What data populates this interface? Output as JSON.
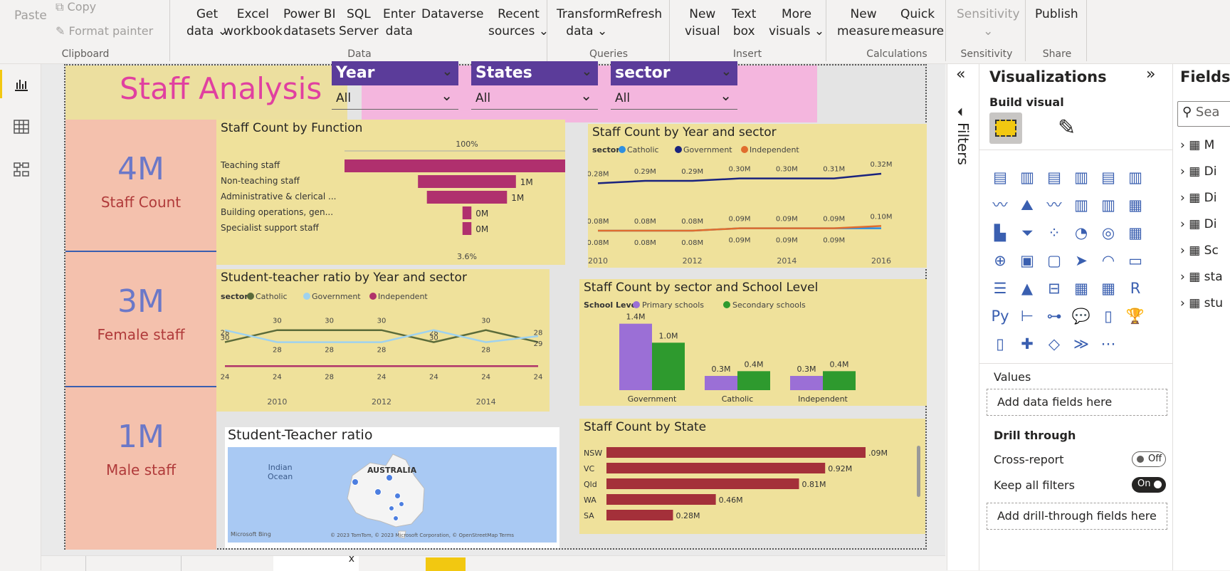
{
  "ribbon": {
    "clipboard": {
      "paste": "Paste",
      "copy": "Copy",
      "format_painter": "Format painter",
      "group": "Clipboard"
    },
    "data": {
      "get_data": "Get",
      "get_data2": "data",
      "excel": "Excel",
      "excel2": "workbook",
      "pbi": "Power BI",
      "pbi2": "datasets",
      "sql": "SQL",
      "sql2": "Server",
      "enter": "Enter",
      "enter2": "data",
      "dataverse": "Dataverse",
      "recent": "Recent",
      "recent2": "sources",
      "group": "Data"
    },
    "queries": {
      "transform": "Transform",
      "transform2": "data",
      "refresh": "Refresh",
      "group": "Queries"
    },
    "insert": {
      "new_visual": "New",
      "new_visual2": "visual",
      "text_box": "Text",
      "text_box2": "box",
      "more": "More",
      "more2": "visuals",
      "group": "Insert"
    },
    "calculations": {
      "new_measure": "New",
      "new_measure2": "measure",
      "quick": "Quick",
      "quick2": "measure",
      "group": "Calculations"
    },
    "sensitivity": {
      "label": "Sensitivity",
      "group": "Sensitivity"
    },
    "share": {
      "publish": "Publish",
      "group": "Share"
    }
  },
  "report": {
    "title": "Staff Analysis",
    "slicers": [
      {
        "label": "Year",
        "value": "All"
      },
      {
        "label": "States",
        "value": "All"
      },
      {
        "label": "sector",
        "value": "All"
      }
    ],
    "kpis": [
      {
        "value": "4M",
        "label": "Staff Count"
      },
      {
        "value": "3M",
        "label": "Female staff"
      },
      {
        "value": "1M",
        "label": "Male staff"
      }
    ],
    "funnel": {
      "title": "Staff Count by Function",
      "top_label": "100%",
      "bottom_label": "3.6%"
    },
    "line1": {
      "title": "Staff Count by Year and sector",
      "legend_title": "sector"
    },
    "line2": {
      "title": "Student-teacher ratio by Year and sector",
      "legend_title": "sector"
    },
    "bar1": {
      "title": "Staff Count by sector and School Level",
      "legend_title": "School Level"
    },
    "bar2": {
      "title": "Staff Count by State"
    },
    "map": {
      "title": "Student-Teacher ratio",
      "ocean": "Indian",
      "ocean2": "Ocean",
      "country": "AUSTRALIA",
      "bing": "Microsoft Bing",
      "copyright": "© 2023 TomTom, © 2023 Microsoft Corporation, © OpenStreetMap  Terms"
    }
  },
  "panes": {
    "filters": "Filters",
    "viz_title": "Visualizations",
    "build_visual": "Build visual",
    "values": "Values",
    "add_data": "Add data fields here",
    "drill_through": "Drill through",
    "cross_report": "Cross-report",
    "cross_report_state": "Off",
    "keep_filters": "Keep all filters",
    "keep_filters_state": "On",
    "add_drill": "Add drill-through fields here",
    "fields_title": "Fields",
    "search_placeholder": "Sea",
    "field_items": [
      "M",
      "Di",
      "Di",
      "Di",
      "Sc",
      "sta",
      "stu"
    ]
  },
  "colors": {
    "catholic_line2": "#5b6b3a",
    "government_line2": "#9fd2ef",
    "independent_line2": "#b0336a",
    "catholic_line1": "#2e8fe0",
    "government_line1": "#1a237e",
    "independent_line1": "#e06d2e",
    "primary": "#9b6fd6",
    "secondary": "#2e9a2e",
    "state_bar": "#a4303a",
    "funnel": "#b0306e",
    "kpi_value": "#6b78c8",
    "kpi_label": "#b03a3a",
    "title_pink": "#e040a0",
    "slicer_header": "#5b3c9a",
    "slicer_bg": "#f4b6de"
  },
  "chart_data": [
    {
      "type": "bar",
      "title": "Staff Count by Function",
      "categories": [
        "Teaching staff",
        "Non-teaching staff",
        "Administrative & clerical ...",
        "Building operations, gen...",
        "Specialist support staff"
      ],
      "values": [
        2.75,
        1.1,
        0.9,
        0.1,
        0.1
      ],
      "data_labels": [
        "",
        "1M",
        "1M",
        "0M",
        "0M"
      ]
    },
    {
      "type": "line",
      "title": "Staff Count by Year and sector",
      "x": [
        2010,
        2011,
        2012,
        2013,
        2014,
        2015,
        2016
      ],
      "x_ticks": [
        "2010",
        "2012",
        "2014",
        "2016"
      ],
      "series": [
        {
          "name": "Catholic",
          "values": [
            0.08,
            0.08,
            0.08,
            0.09,
            0.09,
            0.09,
            0.09
          ],
          "labels": [
            "0.08M",
            "0.08M",
            "0.08M",
            "0.09M",
            "0.09M",
            "0.09M",
            ""
          ]
        },
        {
          "name": "Government",
          "values": [
            0.28,
            0.29,
            0.29,
            0.3,
            0.3,
            0.3,
            0.32
          ],
          "labels": [
            "0.28M",
            "0.29M",
            "0.29M",
            "0.30M",
            "0.30M",
            "0.31M",
            "0.32M"
          ]
        },
        {
          "name": "Independent",
          "values": [
            0.08,
            0.08,
            0.08,
            0.09,
            0.09,
            0.09,
            0.1
          ],
          "labels": [
            "0.08M",
            "0.08M",
            "0.08M",
            "0.09M",
            "0.09M",
            "0.09M",
            "0.10M"
          ]
        }
      ]
    },
    {
      "type": "line",
      "title": "Student-teacher ratio by Year and sector",
      "x": [
        2009,
        2010,
        2011,
        2012,
        2013,
        2014,
        2015
      ],
      "x_ticks": [
        "2010",
        "2012",
        "2014"
      ],
      "series": [
        {
          "name": "Catholic",
          "values": [
            28,
            30,
            30,
            30,
            28,
            30,
            28
          ],
          "labels": [
            "28",
            "30",
            "30",
            "30",
            "28",
            "30",
            "28"
          ]
        },
        {
          "name": "Government",
          "values": [
            30,
            28,
            28,
            28,
            30,
            28,
            29
          ],
          "labels": [
            "30",
            "28",
            "28",
            "28",
            "30",
            "28",
            "29"
          ]
        },
        {
          "name": "Independent",
          "values": [
            24,
            24,
            24,
            24,
            24,
            24,
            24
          ],
          "labels": [
            "24",
            "24",
            "28",
            "24",
            "24",
            "24",
            "24"
          ]
        }
      ]
    },
    {
      "type": "bar",
      "title": "Staff Count by sector and School Level",
      "categories": [
        "Government",
        "Catholic",
        "Independent"
      ],
      "series": [
        {
          "name": "Primary schools",
          "values": [
            1.4,
            0.3,
            0.3
          ],
          "labels": [
            "1.4M",
            "0.3M",
            "0.3M"
          ]
        },
        {
          "name": "Secondary schools",
          "values": [
            1.0,
            0.4,
            0.4
          ],
          "labels": [
            "1.0M",
            "0.4M",
            "0.4M"
          ]
        }
      ]
    },
    {
      "type": "bar",
      "title": "Staff Count by State",
      "categories": [
        "NSW",
        "VC",
        "Qld",
        "WA",
        "SA"
      ],
      "values": [
        1.09,
        0.92,
        0.81,
        0.46,
        0.28
      ],
      "labels": [
        ".09M",
        "0.92M",
        "0.81M",
        "0.46M",
        "0.28M"
      ]
    }
  ]
}
